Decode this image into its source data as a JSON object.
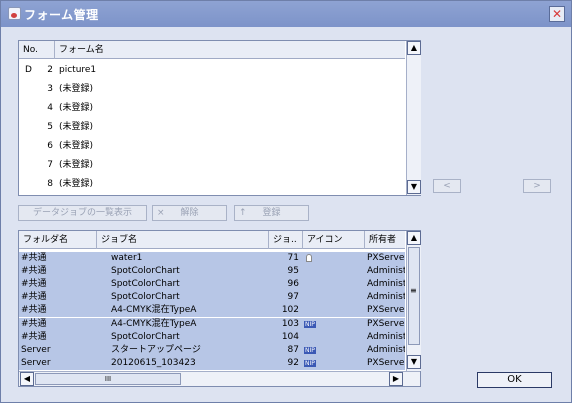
{
  "window": {
    "title": "フォーム管理",
    "close_symbol": "✕"
  },
  "form_list": {
    "columns": [
      "No.",
      "フォーム名"
    ],
    "rows": [
      {
        "flag": "D",
        "no": "2",
        "name": "picture1"
      },
      {
        "flag": "",
        "no": "3",
        "name": "(未登録)"
      },
      {
        "flag": "",
        "no": "4",
        "name": "(未登録)"
      },
      {
        "flag": "",
        "no": "5",
        "name": "(未登録)"
      },
      {
        "flag": "",
        "no": "6",
        "name": "(未登録)"
      },
      {
        "flag": "",
        "no": "7",
        "name": "(未登録)"
      },
      {
        "flag": "",
        "no": "8",
        "name": "(未登録)"
      }
    ]
  },
  "nav": {
    "prev": "<",
    "next": ">"
  },
  "actions": {
    "show_data_jobs": "データジョブの一覧表示",
    "release": "解除",
    "register": "登録",
    "release_mark": "×",
    "register_mark": "↑"
  },
  "job_list": {
    "columns": [
      "フォルダ名",
      "ジョブ名",
      "ジョ..",
      "アイコン",
      "所有者"
    ],
    "rows": [
      {
        "folder": "#共通",
        "job": "water1",
        "num": "71",
        "icon": "lock",
        "owner": "PXServer"
      },
      {
        "folder": "#共通",
        "job": "SpotColorChart",
        "num": "95",
        "icon": "",
        "owner": "Administ"
      },
      {
        "folder": "#共通",
        "job": "SpotColorChart",
        "num": "96",
        "icon": "",
        "owner": "Administ"
      },
      {
        "folder": "#共通",
        "job": "SpotColorChart",
        "num": "97",
        "icon": "",
        "owner": "Administ"
      },
      {
        "folder": "#共通",
        "job": "A4-CMYK混在TypeA",
        "num": "102",
        "icon": "",
        "owner": "PXServer"
      },
      {
        "folder": "#共通",
        "job": "A4-CMYK混在TypeA",
        "num": "103",
        "icon": "NIP",
        "owner": "PXServer"
      },
      {
        "folder": "#共通",
        "job": "SpotColorChart",
        "num": "104",
        "icon": "",
        "owner": "Administ"
      },
      {
        "folder": "Server",
        "job": "スタートアップページ",
        "num": "87",
        "icon": "NIP",
        "owner": "Administ"
      },
      {
        "folder": "Server",
        "job": "20120615_103423",
        "num": "92",
        "icon": "NIP",
        "owner": "PXServer"
      }
    ],
    "hscroll_grip": "III"
  },
  "ok_label": "OK",
  "icons": {
    "up": "▲",
    "down": "▼",
    "left": "◀",
    "right": "▶",
    "grip": "≡"
  }
}
